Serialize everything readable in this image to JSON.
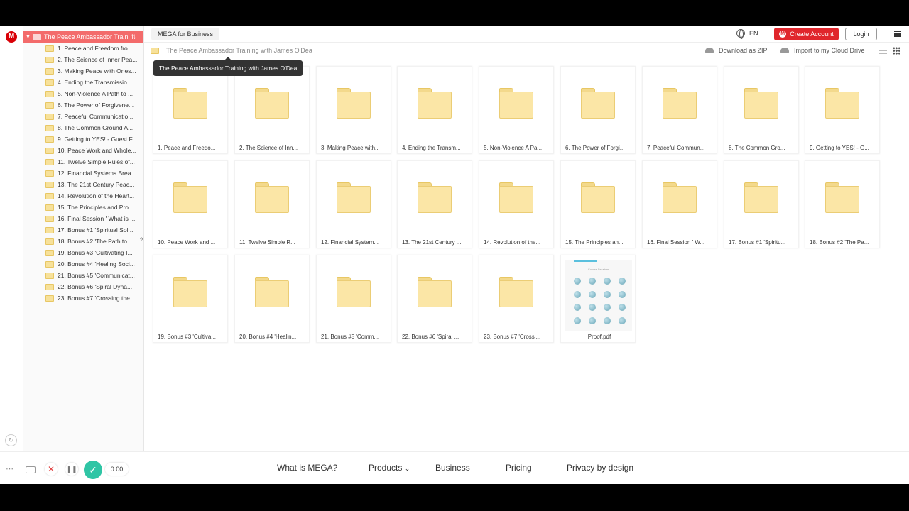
{
  "header": {
    "business_tab": "MEGA for Business",
    "language": "EN",
    "create_account": "Create Account",
    "login": "Login"
  },
  "breadcrumb": {
    "folder_name": "The Peace Ambassador Training with James O'Dea",
    "download_zip": "Download as ZIP",
    "import_label": "Import to my Cloud Drive"
  },
  "tooltip": "The Peace Ambassador Training with James O'Dea",
  "sidebar": {
    "root": "The Peace Ambassador Traini...",
    "items": [
      "1. Peace and Freedom fro...",
      "2. The Science of Inner Pea...",
      "3. Making Peace with Ones...",
      "4. Ending the Transmissio...",
      "5. Non-Violence A Path to ...",
      "6. The Power of Forgivene...",
      "7. Peaceful Communicatio...",
      "8. The Common Ground A...",
      "9. Getting to YES! - Guest F...",
      "10. Peace Work and Whole...",
      "11. Twelve Simple Rules of...",
      "12. Financial Systems Brea...",
      "13. The 21st Century Peac...",
      "14. Revolution of the Heart...",
      "15. The Principles and Pro...",
      "16. Final Session ' What is ...",
      "17. Bonus #1 'Spiritual Sol...",
      "18. Bonus #2 'The Path to ...",
      "19. Bonus #3 'Cultivating I...",
      "20. Bonus #4 'Healing Soci...",
      "21. Bonus #5 'Communicat...",
      "22. Bonus #6 'Spiral Dyna...",
      "23. Bonus #7 'Crossing the ..."
    ]
  },
  "files": [
    "1. Peace and Freedo...",
    "2. The Science of Inn...",
    "3. Making Peace with...",
    "4. Ending the Transm...",
    "5. Non-Violence A Pa...",
    "6. The Power of Forgi...",
    "7. Peaceful Commun...",
    "8. The Common Gro...",
    "9. Getting to YES! - G...",
    "10. Peace Work and ...",
    "11. Twelve Simple R...",
    "12. Financial System...",
    "13. The 21st Century ...",
    "14. Revolution of the...",
    "15. The Principles an...",
    "16. Final Session ' W...",
    "17. Bonus #1 'Spiritu...",
    "18. Bonus #2 'The Pa...",
    "19. Bonus #3 'Cultiva...",
    "20. Bonus #4 'Healin...",
    "21. Bonus #5 'Comm...",
    "22. Bonus #6 'Spiral ...",
    "23. Bonus #7 'Crossi..."
  ],
  "pdf": {
    "name": "Proof.pdf",
    "thumb_title": "Course Sessions"
  },
  "footer": {
    "what_is": "What is MEGA?",
    "products": "Products",
    "business": "Business",
    "pricing": "Pricing",
    "privacy": "Privacy by design"
  },
  "recorder": {
    "time": "0:00"
  },
  "colors": {
    "mega_red": "#d90007",
    "folder_yellow": "#fbe6a6",
    "sidebar_selected": "#f36b6b",
    "record_check": "#2fc5a5"
  }
}
